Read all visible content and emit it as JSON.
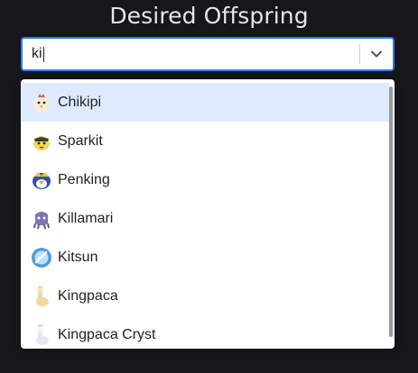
{
  "title": "Desired Offspring",
  "search": {
    "value": "ki"
  },
  "options": [
    {
      "label": "Chikipi",
      "icon": "chikipi-icon",
      "focused": true
    },
    {
      "label": "Sparkit",
      "icon": "sparkit-icon",
      "focused": false
    },
    {
      "label": "Penking",
      "icon": "penking-icon",
      "focused": false
    },
    {
      "label": "Killamari",
      "icon": "killamari-icon",
      "focused": false
    },
    {
      "label": "Kitsun",
      "icon": "kitsun-icon",
      "focused": false
    },
    {
      "label": "Kingpaca",
      "icon": "kingpaca-icon",
      "focused": false
    },
    {
      "label": "Kingpaca Cryst",
      "icon": "kingpaca-cryst-icon",
      "focused": false
    }
  ],
  "colors": {
    "background": "#17171b",
    "focus_border": "#2f7bf0",
    "option_focused_bg": "#deebff"
  }
}
